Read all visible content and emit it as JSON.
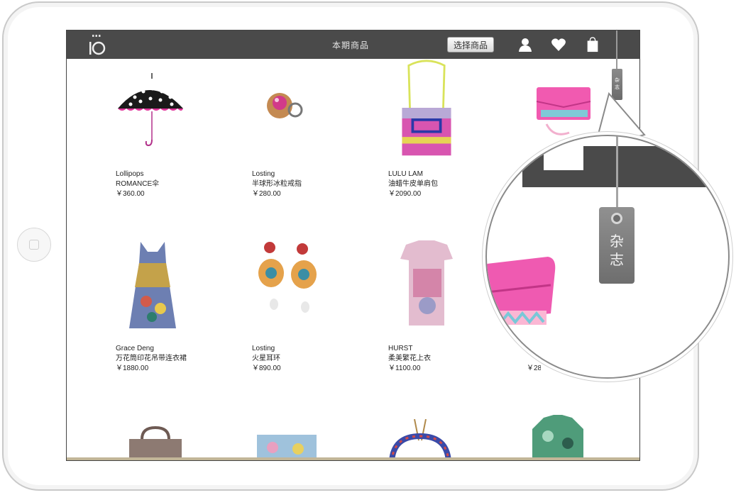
{
  "topbar": {
    "title": "本期商品",
    "select_button": "选择商品",
    "logo_text": "IO"
  },
  "tag": {
    "small_label_line1": "杂",
    "small_label_line2": "志",
    "big_label_line1": "杂",
    "big_label_line2": "志"
  },
  "products": [
    {
      "brand": "Lollipops",
      "name": "ROMANCE伞",
      "price": "￥360.00"
    },
    {
      "brand": "Losting",
      "name": "半球形冰粒戒指",
      "price": "￥280.00"
    },
    {
      "brand": "LULU LAM",
      "name": "油蜡牛皮单肩包",
      "price": "￥2090.00"
    },
    {
      "brand": "Grace Deng",
      "name": "万花筒印花吊带连衣裙",
      "price": "￥1880.00"
    },
    {
      "brand": "Losting",
      "name": "火星耳环",
      "price": "￥890.00"
    },
    {
      "brand": "HURST",
      "name": "柔美繁花上衣",
      "price": "￥1100.00"
    }
  ],
  "partial_price_row2_col4": "￥28",
  "colors": {
    "topbar": "#4a4a4a",
    "tag": "#7a7a7a",
    "accent_pink": "#e0349a"
  },
  "icons": [
    "logo-icon",
    "user-icon",
    "heart-icon",
    "shopping-bag-icon"
  ]
}
